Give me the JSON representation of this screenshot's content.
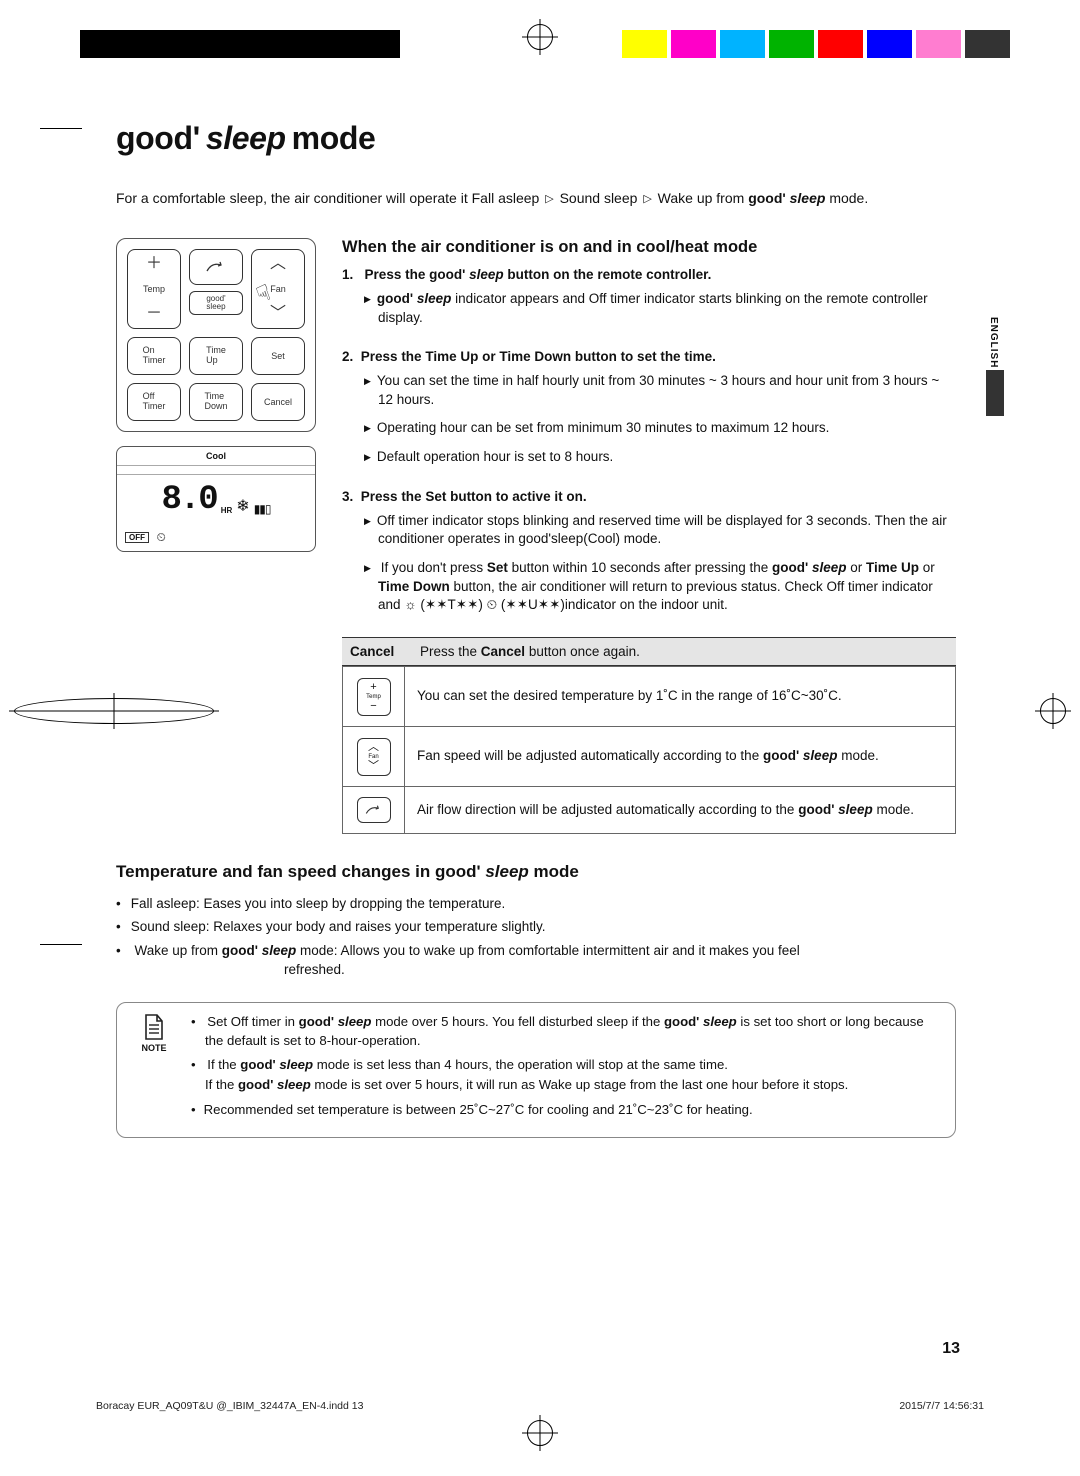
{
  "title": {
    "good": "good'",
    "sleep": "sleep",
    "mode": "mode"
  },
  "intro_a": "For a comfortable sleep, the air conditioner will operate it Fall asleep ",
  "intro_b": " Sound sleep ",
  "intro_c": " Wake up from ",
  "intro_d": " mode.",
  "gs_good": "good'",
  "gs_sleep": "sleep",
  "remote": {
    "temp": "Temp",
    "fan": "Fan",
    "goodsleep_l1": "good'",
    "goodsleep_l2": "sleep",
    "on_timer": "On\nTimer",
    "time_up": "Time\nUp",
    "set": "Set",
    "off_timer": "Off\nTimer",
    "time_down": "Time\nDown",
    "cancel": "Cancel"
  },
  "display": {
    "cool": "Cool",
    "value": "8.0",
    "hr": "HR",
    "off": "OFF"
  },
  "section1_title": "When the air conditioner is on and in cool/heat mode",
  "steps": {
    "s1_head_a": "Press the ",
    "s1_head_b": " button on the remote controller.",
    "s1_b1_a": "",
    "s1_b1_b": " indicator appears and Off timer indicator starts blinking on the remote controller display.",
    "s2_head": "Press the Time Up or Time Down button to set the time.",
    "s2_b1": "You can set the time in half hourly unit from 30 minutes ~ 3 hours and hour unit from 3 hours ~ 12 hours.",
    "s2_b2": "Operating hour can be set from minimum 30 minutes to maximum 12 hours.",
    "s2_b3": "Default operation hour is set to 8 hours.",
    "s3_head": "Press the Set button to active it on.",
    "s3_b1": "Off timer indicator stops blinking and reserved time will be displayed for 3 seconds. Then the air conditioner operates in good'sleep(Cool) mode.",
    "s3_b2_a": "If you don't press ",
    "s3_b2_set": "Set",
    "s3_b2_b": " button within 10 seconds after pressing the ",
    "s3_b2_c": " or ",
    "s3_b2_tu": "Time Up",
    "s3_b2_or": " or ",
    "s3_b2_td": "Time Down",
    "s3_b2_d": " button, the air conditioner will return to previous status. Check Off timer indicator and ",
    "s3_b2_sym1": "☼ (✶✶T✶✶) ",
    "s3_b2_sym2": "⏲ (✶✶U✶✶)",
    "s3_b2_e": "indicator on the indoor unit."
  },
  "cancel_label": "Cancel",
  "cancel_text_a": "Press the ",
  "cancel_text_b": "Cancel",
  "cancel_text_c": " button once again.",
  "grid": {
    "temp_label": "Temp",
    "temp_text": "You can set the desired temperature by 1˚C in the range of 16˚C~30˚C.",
    "fan_label": "Fan",
    "fan_text_a": "Fan speed will be adjusted automatically according to the ",
    "fan_text_b": " mode.",
    "swing_text_a": "Air flow direction will be adjusted automatically according to the ",
    "swing_text_b": " mode."
  },
  "section2_title_a": "Temperature and fan speed changes in ",
  "section2_title_b": " mode",
  "phases": {
    "p1": "Fall asleep: Eases you into sleep by dropping the temperature.",
    "p2": "Sound sleep: Relaxes your body and raises your temperature slightly.",
    "p3_a": "Wake up from ",
    "p3_b": " mode: Allows you to wake up from comfortable intermittent air and it makes you feel",
    "p3_c": "refreshed."
  },
  "note_label": "NOTE",
  "notes": {
    "n1_a": "Set Off timer in ",
    "n1_b": " mode over 5 hours. You fell disturbed sleep if the ",
    "n1_c": " is set too short or long because the default is set to 8-hour-operation.",
    "n2_a": "If the ",
    "n2_b": " mode is set less than 4 hours, the operation will stop at the same time.",
    "n2_c": "If the ",
    "n2_d": " mode is set over 5 hours, it will run as Wake up stage from the last one hour before it stops.",
    "n3": "Recommended set temperature is between 25˚C~27˚C for cooling and 21˚C~23˚C for heating."
  },
  "lang_tab": "ENGLISH",
  "page_number": "13",
  "footer_left": "Boracay EUR_AQ09T&U @_IBIM_32447A_EN-4.indd   13",
  "footer_right": "2015/7/7   14:56:31"
}
